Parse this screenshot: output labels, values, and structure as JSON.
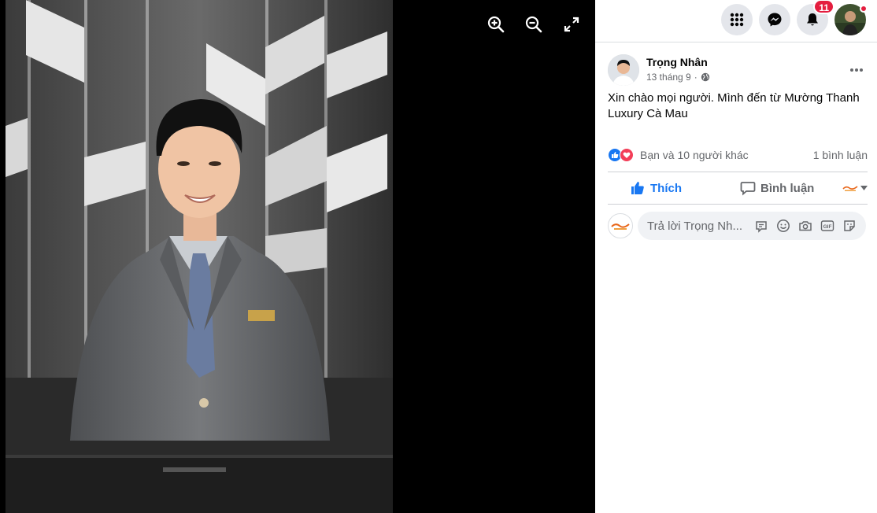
{
  "viewer": {
    "photo_alt": "Trọng Nhân photo",
    "tools": [
      {
        "name": "zoom-in",
        "icon": "zoom-in-icon"
      },
      {
        "name": "zoom-out",
        "icon": "zoom-out-icon"
      },
      {
        "name": "fullscreen",
        "icon": "fullscreen-icon"
      }
    ]
  },
  "topbar": {
    "menu_icon": "grid-menu-icon",
    "messenger_icon": "messenger-icon",
    "notifications_icon": "bell-icon",
    "notification_count": "11"
  },
  "post": {
    "author": "Trọng Nhân",
    "date": "13 tháng 9",
    "privacy_icon": "globe-icon",
    "text": "Xin chào mọi người. Mình đến từ Mường Thanh Luxury Cà Mau",
    "reactions": {
      "icons": [
        "like-reaction-icon",
        "love-reaction-icon"
      ],
      "summary": "Bạn và 10 người khác"
    },
    "comments_count": "1 bình luận",
    "actions": {
      "like": "Thích",
      "comment": "Bình luận"
    },
    "reply": {
      "placeholder": "Trả lời Trọng Nh...",
      "tools": [
        "sticker-comment-icon",
        "emoji-icon",
        "camera-icon",
        "gif-icon",
        "sticker-icon"
      ]
    }
  },
  "colors": {
    "accent": "#1877f2",
    "badge": "#e41e3f",
    "love": "#f33e58"
  }
}
